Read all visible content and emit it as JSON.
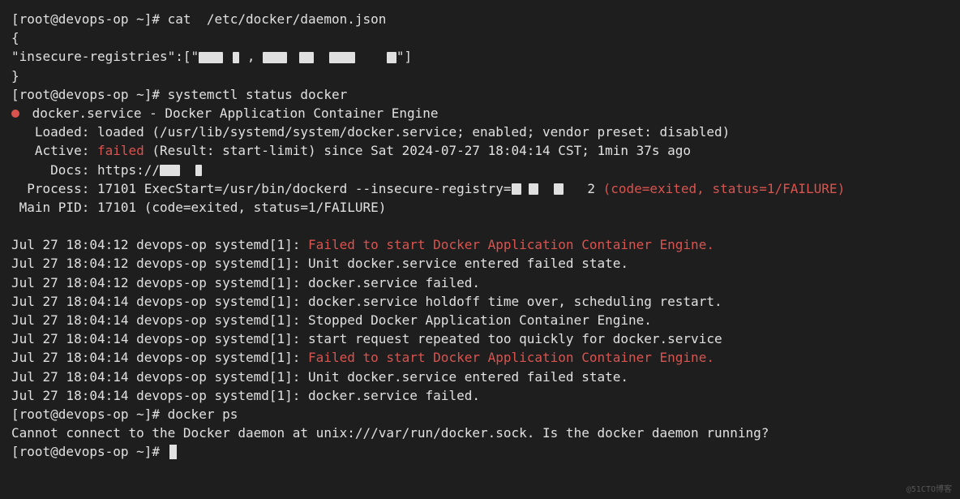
{
  "prompt1": "[root@devops-op ~]# cat  /etc/docker/daemon.json",
  "json_open": "{",
  "json_line": "\"insecure-registries\":[\"",
  "json_line_end": "\"]",
  "json_close": "}",
  "prompt2": "[root@devops-op ~]# systemctl status docker",
  "service_name": " docker.service - Docker Application Container Engine",
  "loaded": "   Loaded: loaded (/usr/lib/systemd/system/docker.service; enabled; vendor preset: disabled)",
  "active_label": "   Active: ",
  "active_status": "failed",
  "active_rest": " (Result: start-limit) since Sat 2024-07-27 18:04:14 CST; 1min 37s ago",
  "docs": "     Docs: https://",
  "process_label": "  Process: 17101 ExecStart=/usr/bin/dockerd --insecure-registry=",
  "process_rest": "2 ",
  "process_error": "(code=exited, status=1/FAILURE)",
  "mainpid": " Main PID: 17101 (code=exited, status=1/FAILURE)",
  "log1_prefix": "Jul 27 18:04:12 devops-op systemd[1]: ",
  "log1_msg": "Failed to start Docker Application Container Engine.",
  "log2": "Jul 27 18:04:12 devops-op systemd[1]: Unit docker.service entered failed state.",
  "log3": "Jul 27 18:04:12 devops-op systemd[1]: docker.service failed.",
  "log4": "Jul 27 18:04:14 devops-op systemd[1]: docker.service holdoff time over, scheduling restart.",
  "log5": "Jul 27 18:04:14 devops-op systemd[1]: Stopped Docker Application Container Engine.",
  "log6": "Jul 27 18:04:14 devops-op systemd[1]: start request repeated too quickly for docker.service",
  "log7_prefix": "Jul 27 18:04:14 devops-op systemd[1]: ",
  "log7_msg": "Failed to start Docker Application Container Engine.",
  "log8": "Jul 27 18:04:14 devops-op systemd[1]: Unit docker.service entered failed state.",
  "log9": "Jul 27 18:04:14 devops-op systemd[1]: docker.service failed.",
  "prompt3": "[root@devops-op ~]# docker ps",
  "docker_error": "Cannot connect to the Docker daemon at unix:///var/run/docker.sock. Is the docker daemon running?",
  "prompt4": "[root@devops-op ~]# ",
  "watermark": "@51CTO博客"
}
